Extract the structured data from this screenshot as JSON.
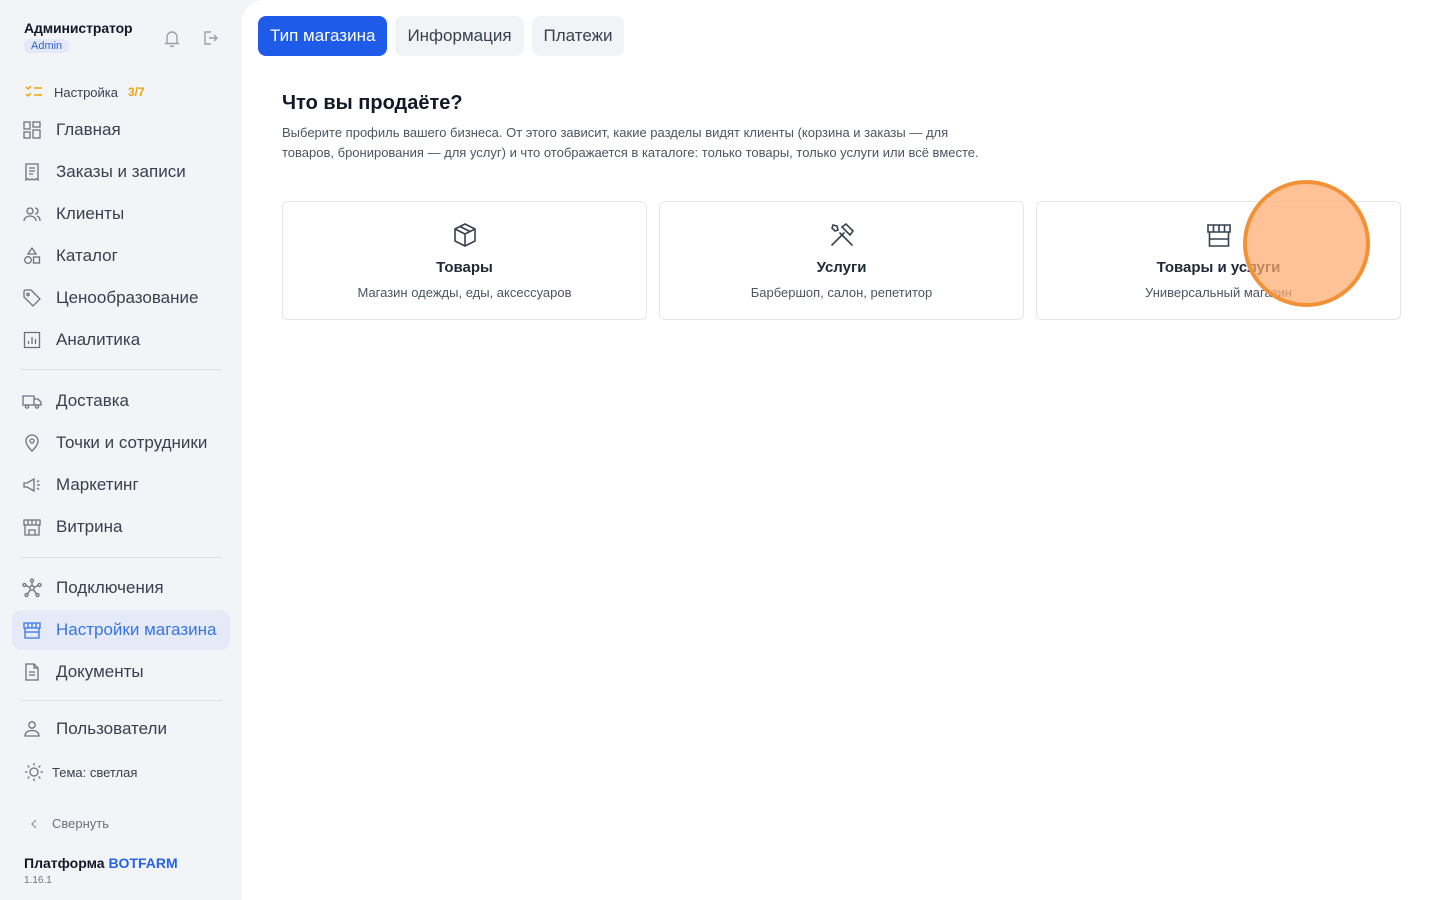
{
  "user": {
    "name": "Администратор",
    "role": "Admin"
  },
  "setup": {
    "label": "Настройка",
    "count": "3/7"
  },
  "nav_main": [
    {
      "label": "Главная",
      "icon": "dashboard-icon"
    },
    {
      "label": "Заказы и записи",
      "icon": "receipt-icon"
    },
    {
      "label": "Клиенты",
      "icon": "users-icon"
    },
    {
      "label": "Каталог",
      "icon": "shapes-icon"
    },
    {
      "label": "Ценообразование",
      "icon": "tag-icon"
    },
    {
      "label": "Аналитика",
      "icon": "chart-icon"
    }
  ],
  "nav_ops": [
    {
      "label": "Доставка",
      "icon": "truck-icon"
    },
    {
      "label": "Точки и сотрудники",
      "icon": "map-pin-icon"
    },
    {
      "label": "Маркетинг",
      "icon": "megaphone-icon"
    },
    {
      "label": "Витрина",
      "icon": "storefront-icon"
    }
  ],
  "nav_settings": [
    {
      "label": "Подключения",
      "icon": "network-icon"
    },
    {
      "label": "Настройки магазина",
      "icon": "store-icon",
      "active": true
    },
    {
      "label": "Документы",
      "icon": "document-icon"
    }
  ],
  "nav_admin": [
    {
      "label": "Пользователи",
      "icon": "user-icon"
    }
  ],
  "theme_label": "Тема: светлая",
  "collapse_label": "Свернуть",
  "brand": {
    "prefix": "Платформа",
    "name": "BOTFARM",
    "version": "1.16.1"
  },
  "tabs": [
    {
      "label": "Тип магазина",
      "active": true
    },
    {
      "label": "Информация",
      "active": false
    },
    {
      "label": "Платежи",
      "active": false
    }
  ],
  "section": {
    "title": "Что вы продаёте?",
    "description": "Выберите профиль вашего бизнеса. От этого зависит, какие разделы видят клиенты (корзина и заказы — для товаров, бронирования — для услуг) и что отображается в каталоге: только товары, только услуги или всё вместе."
  },
  "cards": [
    {
      "title": "Товары",
      "subtitle": "Магазин одежды, еды, аксессуаров",
      "icon": "box-icon"
    },
    {
      "title": "Услуги",
      "subtitle": "Барбершоп, салон, репетитор",
      "icon": "tools-icon"
    },
    {
      "title": "Товары и услуги",
      "subtitle": "Универсальный магазин",
      "icon": "storefront-icon"
    }
  ],
  "colors": {
    "accent": "#1d5be8",
    "active_nav": "#3a74e0",
    "setup_count": "#f0a20b",
    "cursor": "#f39137"
  }
}
